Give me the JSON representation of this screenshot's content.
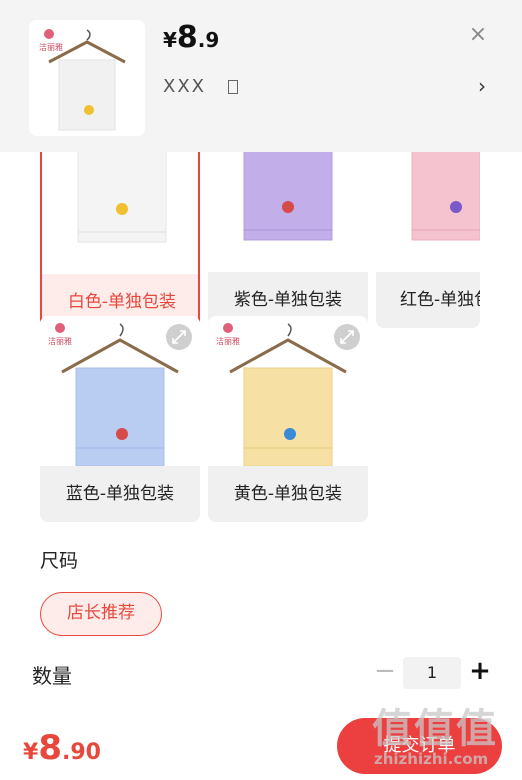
{
  "header": {
    "price_currency": "¥",
    "price_integer": "8",
    "price_decimal": ".9",
    "close_icon": "×",
    "selected_spec": "XXX",
    "chevron": "›"
  },
  "colors": {
    "accent": "#e8483c",
    "submit": "#ec3f3f"
  },
  "color_options": [
    {
      "label": "白色-单独包装",
      "towel_color": "#f4f4f4",
      "selected": true
    },
    {
      "label": "紫色-单独包装",
      "towel_color": "#c2aee8",
      "selected": false
    },
    {
      "label": "红色-单独包装",
      "towel_color": "#f5c3cf",
      "selected": false
    },
    {
      "label": "蓝色-单独包装",
      "towel_color": "#b9cdf3",
      "selected": false
    },
    {
      "label": "黄色-单独包装",
      "towel_color": "#f6e0a4",
      "selected": false
    }
  ],
  "size": {
    "title": "尺码",
    "option": "店长推荐"
  },
  "quantity": {
    "title": "数量",
    "minus": "−",
    "value": "1",
    "plus": "+"
  },
  "footer": {
    "total_currency": "¥",
    "total_integer": "8",
    "total_decimal": ".90",
    "submit_label": "提交订单"
  },
  "watermark": {
    "big": "值值值",
    "small": "zhizhizhi.com"
  }
}
